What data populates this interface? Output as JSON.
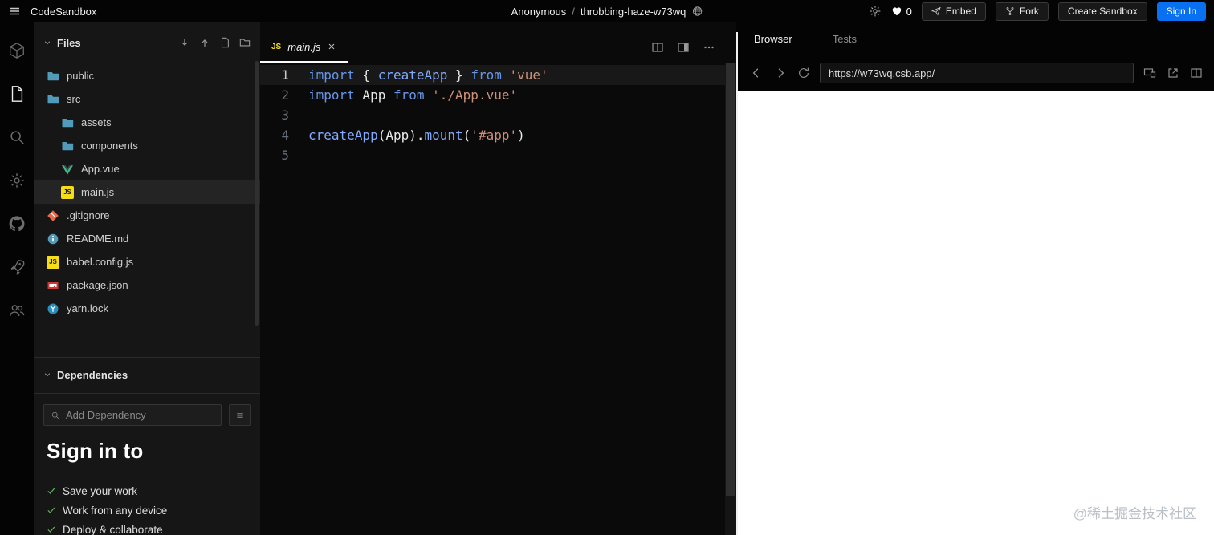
{
  "header": {
    "app_title": "CodeSandbox",
    "breadcrumb": {
      "user": "Anonymous",
      "separator": "/",
      "sandbox_name": "throbbing-haze-w73wq"
    },
    "likes_count": "0",
    "buttons": {
      "embed": "Embed",
      "fork": "Fork",
      "create_sandbox": "Create Sandbox",
      "sign_in": "Sign In"
    }
  },
  "activity_bar": {
    "items": [
      "codesandbox-logo",
      "file-explorer",
      "search",
      "settings",
      "github",
      "deployment",
      "live"
    ]
  },
  "sidebar": {
    "files_panel": {
      "title": "Files"
    },
    "file_tree": [
      {
        "label": "public",
        "type": "folder",
        "depth": 0,
        "selected": false
      },
      {
        "label": "src",
        "type": "folder",
        "depth": 0,
        "selected": false
      },
      {
        "label": "assets",
        "type": "folder",
        "depth": 1,
        "selected": false
      },
      {
        "label": "components",
        "type": "folder",
        "depth": 1,
        "selected": false
      },
      {
        "label": "App.vue",
        "type": "vue",
        "depth": 1,
        "selected": false
      },
      {
        "label": "main.js",
        "type": "js",
        "depth": 1,
        "selected": true
      },
      {
        "label": ".gitignore",
        "type": "git",
        "depth": 0,
        "selected": false
      },
      {
        "label": "README.md",
        "type": "md",
        "depth": 0,
        "selected": false
      },
      {
        "label": "babel.config.js",
        "type": "js",
        "depth": 0,
        "selected": false
      },
      {
        "label": "package.json",
        "type": "npm",
        "depth": 0,
        "selected": false
      },
      {
        "label": "yarn.lock",
        "type": "yarn",
        "depth": 0,
        "selected": false
      }
    ],
    "dependencies_panel": {
      "title": "Dependencies",
      "add_placeholder": "Add Dependency"
    },
    "signin_promo": {
      "title": "Sign in to",
      "benefits": [
        "Save your work",
        "Work from any device",
        "Deploy & collaborate"
      ]
    }
  },
  "editor": {
    "tab": {
      "badge": "JS",
      "label": "main.js"
    },
    "code_lines": [
      {
        "number": "1",
        "active": true,
        "tokens": [
          {
            "t": "import",
            "c": "kw"
          },
          {
            "t": " { ",
            "c": "pl"
          },
          {
            "t": "createApp",
            "c": "fn"
          },
          {
            "t": " } ",
            "c": "pl"
          },
          {
            "t": "from",
            "c": "kw"
          },
          {
            "t": " ",
            "c": "pl"
          },
          {
            "t": "'vue'",
            "c": "str"
          }
        ]
      },
      {
        "number": "2",
        "active": false,
        "tokens": [
          {
            "t": "import",
            "c": "kw"
          },
          {
            "t": " App ",
            "c": "pl"
          },
          {
            "t": "from",
            "c": "kw"
          },
          {
            "t": " ",
            "c": "pl"
          },
          {
            "t": "'./App.vue'",
            "c": "str"
          }
        ]
      },
      {
        "number": "3",
        "active": false,
        "tokens": []
      },
      {
        "number": "4",
        "active": false,
        "tokens": [
          {
            "t": "createApp",
            "c": "fn"
          },
          {
            "t": "(App).",
            "c": "pl"
          },
          {
            "t": "mount",
            "c": "fn"
          },
          {
            "t": "(",
            "c": "pl"
          },
          {
            "t": "'#app'",
            "c": "str"
          },
          {
            "t": ")",
            "c": "pl"
          }
        ]
      },
      {
        "number": "5",
        "active": false,
        "tokens": []
      }
    ]
  },
  "preview": {
    "tabs": [
      {
        "label": "Browser",
        "active": true
      },
      {
        "label": "Tests",
        "active": false
      }
    ],
    "url": "https://w73wq.csb.app/",
    "watermark": "@稀土掘金技术社区"
  },
  "colors": {
    "accent_blue": "#0971f1",
    "js_yellow": "#f5de19",
    "vue_green": "#41b883",
    "keyword_blue": "#6796e6",
    "string_orange": "#ce9178"
  }
}
